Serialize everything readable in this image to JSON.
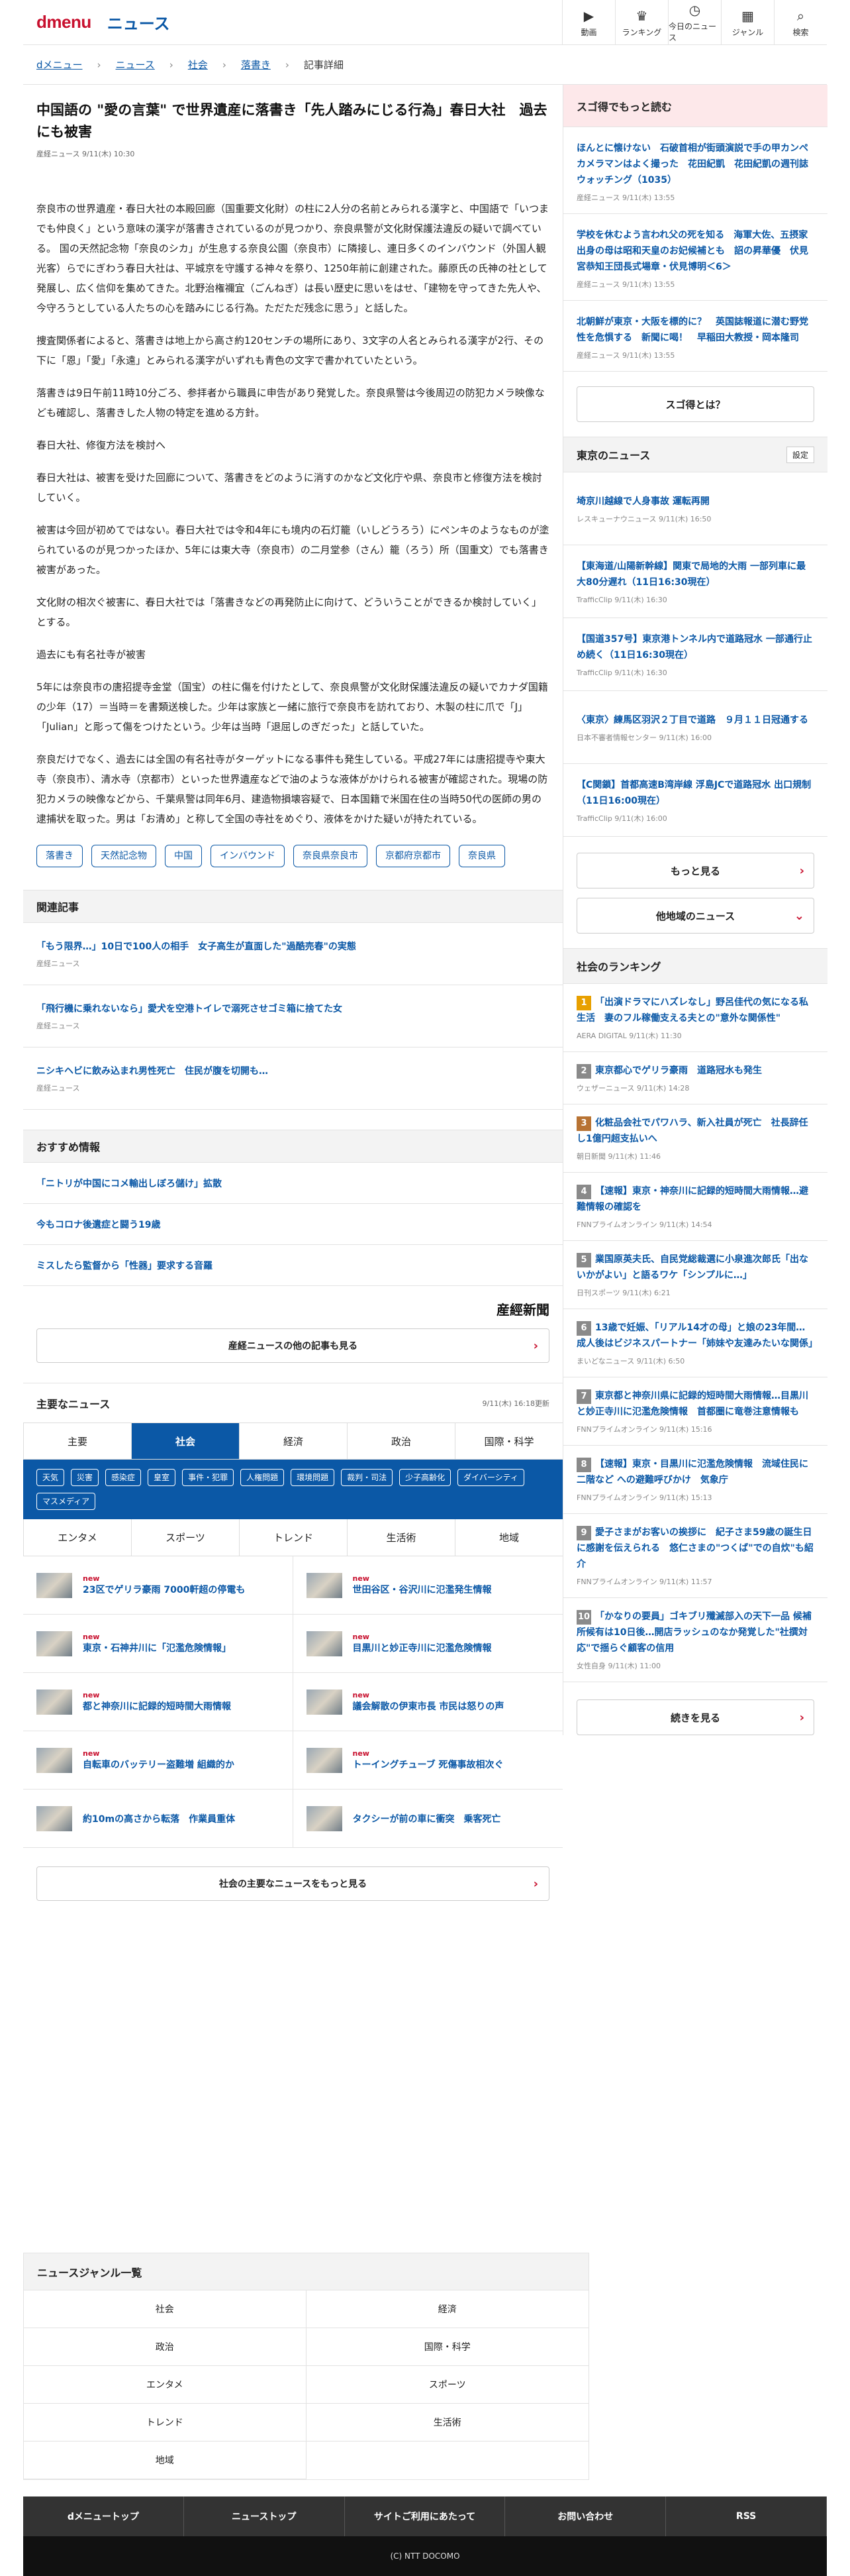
{
  "header": {
    "logo_d": "d",
    "logo_menu": "menu",
    "section": "ニュース",
    "nav": [
      {
        "icon": "▶",
        "label": "動画"
      },
      {
        "icon": "♛",
        "label": "ランキング"
      },
      {
        "icon": "◷",
        "label": "今日のニュース"
      },
      {
        "icon": "▦",
        "label": "ジャンル"
      },
      {
        "icon": "⌕",
        "label": "検索"
      }
    ]
  },
  "breadcrumb": [
    "dメニュー",
    "ニュース",
    "社会",
    "落書き",
    "記事詳細"
  ],
  "article": {
    "title": "中国語の \"愛の言葉\" で世界遺産に落書き「先人踏みにじる行為」春日大社　過去にも被害",
    "meta": "産経ニュース 9/11(木) 10:30",
    "paragraphs": [
      "奈良市の世界遺産・春日大社の本殿回廊（国重要文化財）の柱に2人分の名前とみられる漢字と、中国語で「いつまでも仲良く」という意味の漢字が落書きされているのが見つかり、奈良県警が文化財保護法違反の疑いで調べている。 国の天然記念物「奈良のシカ」が生息する奈良公園（奈良市）に隣接し、連日多くのインバウンド（外国人観光客）らでにぎわう春日大社は、平城京を守護する神々を祭り、1250年前に創建された。藤原氏の氏神の社として発展し、広く信仰を集めてきた。北野治権禰宜（ごんねぎ）は長い歴史に思いをはせ、「建物を守ってきた先人や、今守ろうとしている人たちの心を踏みにじる行為。ただただ残念に思う」と話した。",
      "捜査関係者によると、落書きは地上から高さ約120センチの場所にあり、3文字の人名とみられる漢字が2行、その下に「恩」「愛」「永遠」とみられる漢字がいずれも青色の文字で書かれていたという。",
      "落書きは9日午前11時10分ごろ、参拝者から職員に申告があり発覚した。奈良県警は今後周辺の防犯カメラ映像なども確認し、落書きした人物の特定を進める方針。",
      "春日大社、修復方法を検討へ",
      "春日大社は、被害を受けた回廊について、落書きをどのように消すのかなど文化庁や県、奈良市と修復方法を検討していく。",
      "被害は今回が初めてではない。春日大社では令和4年にも境内の石灯籠（いしどうろう）にペンキのようなものが塗られているのが見つかったほか、5年には東大寺（奈良市）の二月堂参（さん）籠（ろう）所（国重文）でも落書き被害があった。",
      "文化財の相次ぐ被害に、春日大社では「落書きなどの再発防止に向けて、どういうことができるか検討していく」とする。",
      "過去にも有名社寺が被害",
      "5年には奈良市の唐招提寺金堂（国宝）の柱に傷を付けたとして、奈良県警が文化財保護法違反の疑いでカナダ国籍の少年（17）＝当時＝を書類送検した。少年は家族と一緒に旅行で奈良市を訪れており、木製の柱に爪で「J」「Julian」と彫って傷をつけたという。少年は当時「退屈しのぎだった」と話していた。",
      "奈良だけでなく、過去には全国の有名社寺がターゲットになる事件も発生している。平成27年には唐招提寺や東大寺（奈良市）、清水寺（京都市）といった世界遺産などで油のような液体がかけられる被害が確認された。現場の防犯カメラの映像などから、千葉県警は同年6月、建造物損壊容疑で、日本国籍で米国在住の当時50代の医師の男の逮捕状を取った。男は「お清め」と称して全国の寺社をめぐり、液体をかけた疑いが持たれている。"
    ],
    "tags": [
      "落書き",
      "天然記念物",
      "中国",
      "インバウンド",
      "奈良県奈良市",
      "京都府京都市",
      "奈良県"
    ]
  },
  "related": {
    "heading": "関連記事",
    "items": [
      {
        "title": "「もう限界…」10日で100人の相手　女子高生が直面した\"過酷売春\"の実態",
        "src": "産経ニュース"
      },
      {
        "title": "「飛行機に乗れないなら」愛犬を空港トイレで溺死させゴミ箱に捨てた女",
        "src": "産経ニュース"
      },
      {
        "title": "ニシキヘビに飲み込まれ男性死亡　住民が腹を切開も…",
        "src": "産経ニュース"
      }
    ]
  },
  "recommend": {
    "heading": "おすすめ情報",
    "items": [
      "「ニトリが中国にコメ輸出しぼろ儲け」拡散",
      "今もコロナ後遺症と闘う19歳",
      "ミスしたら監督から「性器」要求する音羅"
    ]
  },
  "sankei_logo": "産經新聞",
  "more_sankei": "産経ニュースの他の記事も見る",
  "major": {
    "heading": "主要なニュース",
    "updated": "9/11(木) 16:18更新",
    "tabs1": [
      "主要",
      "社会",
      "経済",
      "政治",
      "国際・科学"
    ],
    "active_tab": "社会",
    "chips": [
      "天気",
      "災害",
      "感染症",
      "皇室",
      "事件・犯罪",
      "人権問題",
      "環境問題",
      "裁判・司法",
      "少子高齢化",
      "ダイバーシティ",
      "マスメディア"
    ],
    "tabs2": [
      "エンタメ",
      "スポーツ",
      "トレンド",
      "生活術",
      "地域"
    ],
    "new_label": "new",
    "items": [
      {
        "title": "23区でゲリラ豪雨 7000軒超の停電も",
        "new": true
      },
      {
        "title": "世田谷区・谷沢川に氾濫発生情報",
        "new": true
      },
      {
        "title": "東京・石神井川に「氾濫危険情報」",
        "new": true
      },
      {
        "title": "目黒川と妙正寺川に氾濫危険情報",
        "new": true
      },
      {
        "title": "都と神奈川に記録的短時間大雨情報",
        "new": true
      },
      {
        "title": "議会解散の伊東市長 市民は怒りの声",
        "new": true
      },
      {
        "title": "自転車のバッテリー盗難増 組織的か",
        "new": true
      },
      {
        "title": "トーイングチューブ 死傷事故相次ぐ",
        "new": true
      },
      {
        "title": "約10mの高さから転落　作業員重体",
        "new": false
      },
      {
        "title": "タクシーが前の車に衝突　乗客死亡",
        "new": false
      }
    ],
    "more": "社会の主要なニュースをもっと見る"
  },
  "sidebar": {
    "sugotoku": {
      "heading": "スゴ得でもっと読む",
      "items": [
        {
          "title": "ほんとに懐けない　石破首相が街頭演説で手の甲カンペ　カメラマンはよく撮った　花田紀凱　花田紀凱の週刊誌ウォッチング（1035）",
          "src": "産経ニュース 9/11(木) 13:55"
        },
        {
          "title": "学校を休むよう言われ父の死を知る　海軍大佐、五摂家出身の母は昭和天皇のお妃候補とも　詔の昇華優　伏見宮恭知王団長式場章・伏見博明＜6＞",
          "src": "産経ニュース 9/11(木) 13:55"
        },
        {
          "title": "北朝鮮が東京・大阪を標的に？　英国誌報道に潜む野党性を危惧する　新聞に喝！　早稲田大教授・岡本隆司",
          "src": "産経ニュース 9/11(木) 13:55"
        }
      ],
      "what": "スゴ得とは？"
    },
    "tokyo": {
      "heading": "東京のニュース",
      "settings": "設定",
      "items": [
        {
          "title": "埼京川越線で人身事故 運転再開",
          "src": "レスキューナウニュース 9/11(木) 16:50"
        },
        {
          "title": "【東海道/山陽新幹線】関東で局地的大雨 一部列車に最大80分遅れ（11日16:30現在）",
          "src": "TrafficClip 9/11(木) 16:30"
        },
        {
          "title": "【国道357号】東京港トンネル内で道路冠水 一部通行止め続く（11日16:30現在）",
          "src": "TrafficClip 9/11(木) 16:30"
        },
        {
          "title": "〈東京〉練馬区羽沢２丁目で道路　９月１１日冠通する",
          "src": "日本不審者情報センター 9/11(木) 16:00"
        },
        {
          "title": "【C関鎖】首都高速B湾岸線 浮島JCで道路冠水 出口規制（11日16:00現在）",
          "src": "TrafficClip 9/11(木) 16:00"
        }
      ],
      "more": "もっと見る",
      "other": "他地域のニュース"
    },
    "ranking": {
      "heading": "社会のランキング",
      "items": [
        {
          "rank": "1",
          "title": "「出演ドラマにハズレなし」野呂佳代の気になる私生活　妻のフル稼働支える夫との\"意外な関係性\"",
          "src": "AERA DIGITAL 9/11(木) 11:30",
          "color": "#e8a000"
        },
        {
          "rank": "2",
          "title": "東京都心でゲリラ豪雨　道路冠水も発生",
          "src": "ウェザーニュース 9/11(木) 14:28",
          "color": "#8a8a8a"
        },
        {
          "rank": "3",
          "title": "化粧品会社でパワハラ、新入社員が死亡　社長辞任し1億円超支払いへ",
          "src": "朝日新聞 9/11(木) 11:46",
          "color": "#b87333"
        },
        {
          "rank": "4",
          "title": "【速報】東京・神奈川に記録的短時間大雨情報…避難情報の確認を",
          "src": "FNNプライムオンライン 9/11(木) 14:54",
          "color": "#8a8a8a"
        },
        {
          "rank": "5",
          "title": "業国原英夫氏、自民党総裁選に小泉進次郎氏「出ないかがよい」と語るワケ「シンプルに…」",
          "src": "日刊スポーツ 9/11(木) 6:21",
          "color": "#8a8a8a"
        },
        {
          "rank": "6",
          "title": "13歳で妊娠、「リアル14才の母」と娘の23年間…成人後はビジネスパートナー「姉妹や友達みたいな関係」",
          "src": "まいどなニュース 9/11(木) 6:50",
          "color": "#8a8a8a"
        },
        {
          "rank": "7",
          "title": "東京都と神奈川県に記録的短時間大雨情報…目黒川と妙正寺川に氾濫危険情報　首都圏に竜巻注意情報も",
          "src": "FNNプライムオンライン 9/11(木) 15:16",
          "color": "#8a8a8a"
        },
        {
          "rank": "8",
          "title": "【速報】東京・目黒川に氾濫危険情報　流域住民に二階など への避難呼びかけ　気象庁",
          "src": "FNNプライムオンライン 9/11(木) 15:13",
          "color": "#8a8a8a"
        },
        {
          "rank": "9",
          "title": "愛子さまがお客いの挨拶に　紀子さま59歳の誕生日に感謝を伝えられる　悠仁さまの\"つくば\"での自炊\"も紹介",
          "src": "FNNプライムオンライン 9/11(木) 11:57",
          "color": "#8a8a8a"
        },
        {
          "rank": "10",
          "title": "「かなりの要員」ゴキブリ殲滅部入の天下一品 候補所候有は10日後…開店ラッシュのなか発覚した\"社撰対応\"で揺らぐ顧客の信用",
          "src": "女性自身 9/11(木) 11:00",
          "color": "#8a8a8a"
        }
      ],
      "more": "続きを見る"
    }
  },
  "genre": {
    "heading": "ニュースジャンル一覧",
    "items": [
      "社会",
      "経済",
      "政治",
      "国際・科学",
      "エンタメ",
      "スポーツ",
      "トレンド",
      "生活術",
      "地域"
    ]
  },
  "footer": {
    "links": [
      "dメニュートップ",
      "ニューストップ",
      "サイトご利用にあたって",
      "お問い合わせ",
      "RSS"
    ],
    "copyright": "(C) NTT DOCOMO"
  }
}
